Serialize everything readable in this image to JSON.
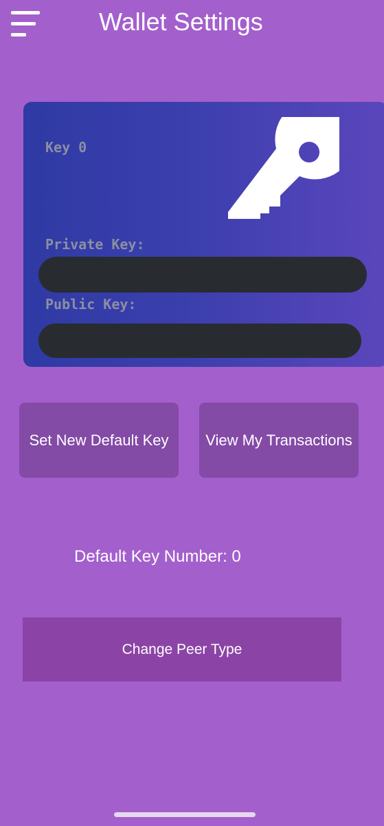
{
  "header": {
    "menu_icon": "hamburger-menu-icon",
    "title": "Wallet Settings"
  },
  "key_card": {
    "key_name": "Key 0",
    "key_icon": "key-icon",
    "private_key_label": "Private Key:",
    "private_key_value": "",
    "public_key_label": "Public Key:",
    "public_key_value": ""
  },
  "actions": {
    "set_default_label": "Set New Default Key",
    "view_transactions_label": "View My Transactions"
  },
  "default_key": {
    "text": "Default Key Number: 0"
  },
  "peer": {
    "change_label": "Change Peer Type"
  },
  "colors": {
    "background": "#a35fcc",
    "card_gradient_start": "#2f3aa4",
    "card_gradient_end": "#5b46bc",
    "button": "#834aa6",
    "peer_button": "#8b44a6",
    "redaction": "#282c30",
    "label_gray": "#8b8fa2"
  }
}
